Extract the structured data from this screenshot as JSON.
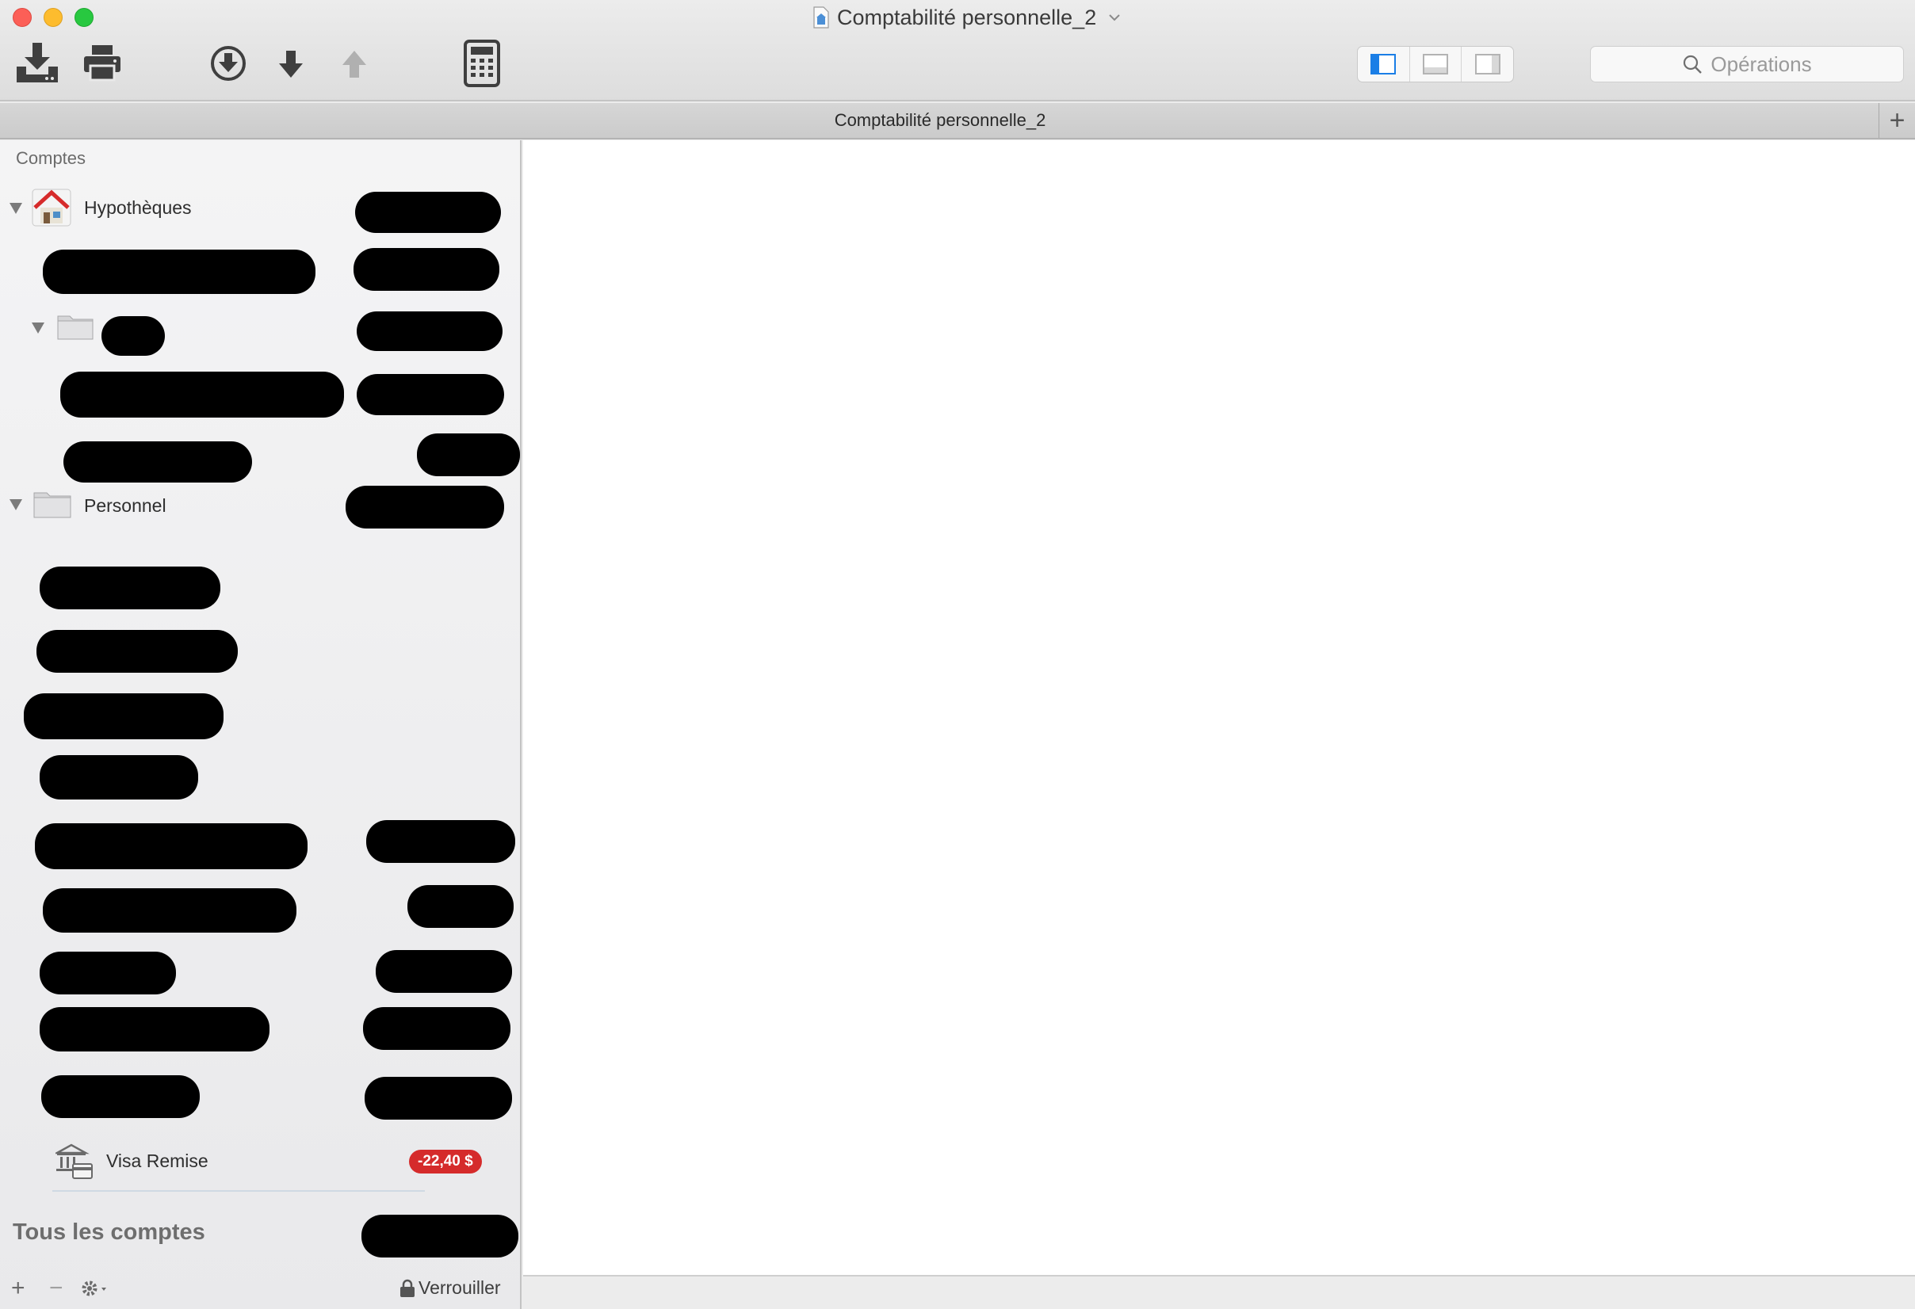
{
  "window": {
    "title": "Comptabilité personnelle_2"
  },
  "toolbar": {
    "buttons": [
      {
        "name": "import-button",
        "icon": "download-tray-icon",
        "enabled": true
      },
      {
        "name": "print-button",
        "icon": "printer-icon",
        "enabled": true
      },
      {
        "name": "download-circle-button",
        "icon": "arrow-down-circle-icon",
        "enabled": true
      },
      {
        "name": "move-down-button",
        "icon": "arrow-down-icon",
        "enabled": true
      },
      {
        "name": "move-up-button",
        "icon": "arrow-up-icon",
        "enabled": false
      },
      {
        "name": "calculator-button",
        "icon": "calculator-icon",
        "enabled": true
      }
    ],
    "view_segments": [
      {
        "name": "show-left-pane",
        "icon": "sidebar-left-icon",
        "selected": true
      },
      {
        "name": "show-bottom-pane",
        "icon": "pane-bottom-icon",
        "selected": false
      },
      {
        "name": "show-right-pane",
        "icon": "sidebar-right-icon",
        "selected": false
      }
    ],
    "search": {
      "placeholder": "Opérations"
    }
  },
  "tabbar": {
    "active_tab": "Comptabilité personnelle_2",
    "add_label": "+"
  },
  "sidebar": {
    "section_title": "Comptes",
    "groups": [
      {
        "label": "Hypothèques",
        "icon": "house-icon",
        "expanded": true
      },
      {
        "label": "Personnel",
        "icon": "folder-icon",
        "expanded": true
      }
    ],
    "visible_account": {
      "label": "Visa Remise",
      "icon": "bank-card-icon",
      "balance": "-22,40 $"
    },
    "total_label": "Tous les comptes",
    "bottom": {
      "add": "+",
      "remove": "−",
      "lock_label": "Verrouiller"
    }
  },
  "colors": {
    "negative_badge": "#d52b2b",
    "selected_segment": "#1a7ee6",
    "redaction": "#000000"
  }
}
